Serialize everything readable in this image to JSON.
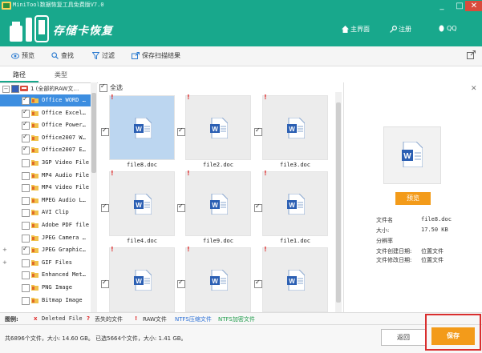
{
  "app": {
    "window_title": "MiniTool数据恢复工具免费版V7.0",
    "product_title": "存储卡恢复",
    "nav": {
      "home": "主界面",
      "register": "注册",
      "qq": "QQ"
    },
    "window_controls": {
      "minimize": "_",
      "maximize": "□",
      "close": "✕"
    }
  },
  "toolbar": {
    "preview": "预览",
    "find": "查找",
    "filter": "过滤",
    "save_scan": "保存扫描结果"
  },
  "tabs": {
    "path": "路径",
    "type": "类型"
  },
  "tree": {
    "root_label": "1 (全部的RAW文…",
    "items": [
      {
        "label": "Office WORD …",
        "checked": true,
        "selected": true,
        "expander": ""
      },
      {
        "label": "Office Excel…",
        "checked": true,
        "selected": false,
        "expander": ""
      },
      {
        "label": "Office Power…",
        "checked": true,
        "selected": false,
        "expander": ""
      },
      {
        "label": "Office2007 W…",
        "checked": true,
        "selected": false,
        "expander": ""
      },
      {
        "label": "Office2007 E…",
        "checked": true,
        "selected": false,
        "expander": ""
      },
      {
        "label": "3GP Video File",
        "checked": false,
        "selected": false,
        "expander": ""
      },
      {
        "label": "MP4 Audio File",
        "checked": false,
        "selected": false,
        "expander": ""
      },
      {
        "label": "MP4 Video File",
        "checked": false,
        "selected": false,
        "expander": ""
      },
      {
        "label": "MPEG Audio L…",
        "checked": false,
        "selected": false,
        "expander": ""
      },
      {
        "label": "AVI Clip",
        "checked": false,
        "selected": false,
        "expander": ""
      },
      {
        "label": "Adobe PDF file",
        "checked": false,
        "selected": false,
        "expander": ""
      },
      {
        "label": "JPEG Camera …",
        "checked": false,
        "selected": false,
        "expander": ""
      },
      {
        "label": "JPEG Graphic…",
        "checked": true,
        "selected": false,
        "expander": "+"
      },
      {
        "label": "GIF Files",
        "checked": false,
        "selected": false,
        "expander": "+"
      },
      {
        "label": "Enhanced Met…",
        "checked": false,
        "selected": false,
        "expander": ""
      },
      {
        "label": "PNG Image",
        "checked": false,
        "selected": false,
        "expander": ""
      },
      {
        "label": "Bitmap Image",
        "checked": false,
        "selected": false,
        "expander": ""
      }
    ]
  },
  "grid": {
    "select_all": "全选",
    "files": [
      {
        "name": "file8.doc",
        "selected": true
      },
      {
        "name": "file2.doc",
        "selected": false
      },
      {
        "name": "file3.doc",
        "selected": false
      },
      {
        "name": "file4.doc",
        "selected": false
      },
      {
        "name": "file9.doc",
        "selected": false
      },
      {
        "name": "file1.doc",
        "selected": false
      },
      {
        "name": "",
        "selected": false
      },
      {
        "name": "",
        "selected": false
      },
      {
        "name": "",
        "selected": false
      }
    ]
  },
  "preview": {
    "button": "预览",
    "labels": {
      "filename": "文件名",
      "size": "大小:",
      "resolution": "分辨率",
      "created": "文件创建日期:",
      "modified": "文件修改日期:"
    },
    "values": {
      "filename": "file8.doc",
      "size": "17.50 KB",
      "resolution": "",
      "created": "位置文件",
      "modified": "位置文件"
    }
  },
  "legend": {
    "title": "图例:",
    "deleted": "Deleted File",
    "lost": "丢失的文件",
    "raw": "RAW文件",
    "ntfs_compressed": "NTFS压缩文件",
    "ntfs_encrypted": "NTFS加密文件",
    "colors": {
      "deleted": "#e03030",
      "lost": "#e03030",
      "raw": "#e03030",
      "ntfs_compressed": "#2a6fd6",
      "ntfs_encrypted": "#1e9b4a"
    }
  },
  "status": {
    "text": "共6896个文件，大小: 14.60 GB。 已选5664个文件，大小: 1.41 GB。"
  },
  "buttons": {
    "back": "返回",
    "save": "保存"
  },
  "colors": {
    "header": "#18a88c",
    "accent": "#f39b1a",
    "selection": "#3d8ee0",
    "highlight": "#d92e2e"
  }
}
